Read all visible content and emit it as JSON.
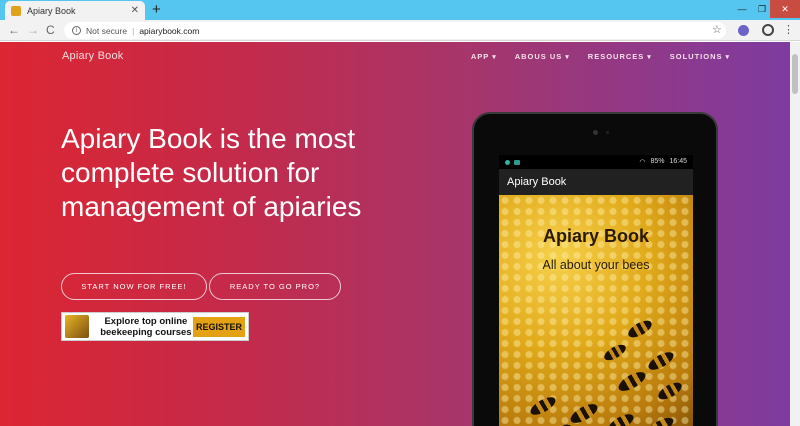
{
  "browser": {
    "tab_title": "Apiary Book",
    "tab_close": "✕",
    "new_tab": "+",
    "security_label": "Not secure",
    "url": "apiarybook.com",
    "back": "←",
    "forward": "→",
    "reload": "C",
    "star": "☆",
    "menu": "⋮",
    "minimize": "—",
    "restore": "❐",
    "close": "✕"
  },
  "site": {
    "brand": "Apiary Book",
    "menu": [
      "APP",
      "ABOUS US",
      "RESOURCES",
      "SOLUTIONS"
    ],
    "hero_line1": "Apiary Book is the most",
    "hero_line2": "complete solution for",
    "hero_line3": "management of apiaries",
    "cta_primary": "START NOW FOR FREE!",
    "cta_secondary": "READY TO GO PRO?"
  },
  "ad": {
    "line1": "Explore top online",
    "line2": "beekeeping courses",
    "button": "REGISTER"
  },
  "tablet": {
    "battery": "85%",
    "time": "16:45",
    "appbar_title": "Apiary Book",
    "splash_title": "Apiary Book",
    "splash_subtitle": "All about your bees"
  },
  "colors": {
    "tab_bar": "#55c6ef",
    "gradient_start": "#dc2632",
    "gradient_end": "#7e3ba0",
    "register_button": "#e5a114"
  }
}
